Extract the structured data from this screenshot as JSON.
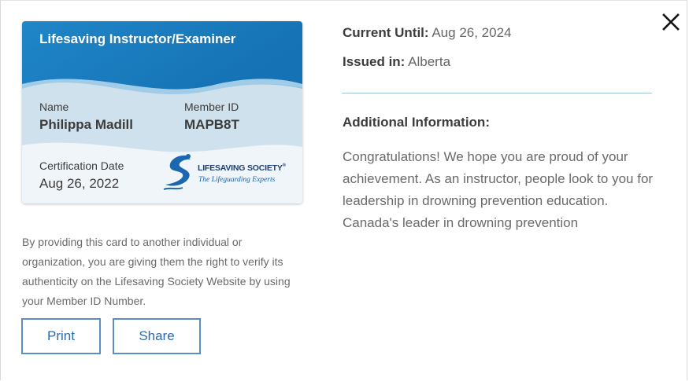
{
  "card": {
    "title": "Lifesaving Instructor/Examiner",
    "name_label": "Name",
    "name_value": "Philippa Madill",
    "member_label": "Member ID",
    "member_value": "MAPB8T",
    "cert_label": "Certification Date",
    "cert_value": "Aug 26, 2022",
    "logo_name": "LIFESAVING SOCIETY",
    "logo_registered": "®",
    "logo_tagline": "The Lifeguarding Experts"
  },
  "disclaimer": "By providing this card to another individual or organization, you are giving them the right to verify its authenticity on the Lifesaving Society Website by using your Member ID Number.",
  "buttons": {
    "print": "Print",
    "share": "Share"
  },
  "details": {
    "current_until_label": "Current Until:",
    "current_until_value": "Aug 26, 2024",
    "issued_in_label": "Issued in:",
    "issued_in_value": "Alberta",
    "additional_title": "Additional Information:",
    "additional_text": "Congratulations! We hope you are proud of your achievement. As an instructor, people look to you for leadership in drowning prevention education. Canada's leader in drowning prevention"
  },
  "icons": {
    "close": "close-icon",
    "logo": "lifesaving-society-logo"
  },
  "colors": {
    "accent": "#2d6bae",
    "card_blue": "#1a7cc0",
    "divider": "#9ec3db"
  }
}
